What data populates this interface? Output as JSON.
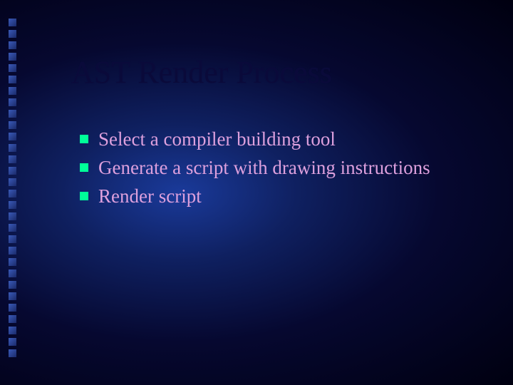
{
  "title": "AST Render Process",
  "bullets": [
    "Select a compiler building tool",
    "Generate a script with drawing instructions",
    "Render script"
  ],
  "leftSquareCount": 30
}
